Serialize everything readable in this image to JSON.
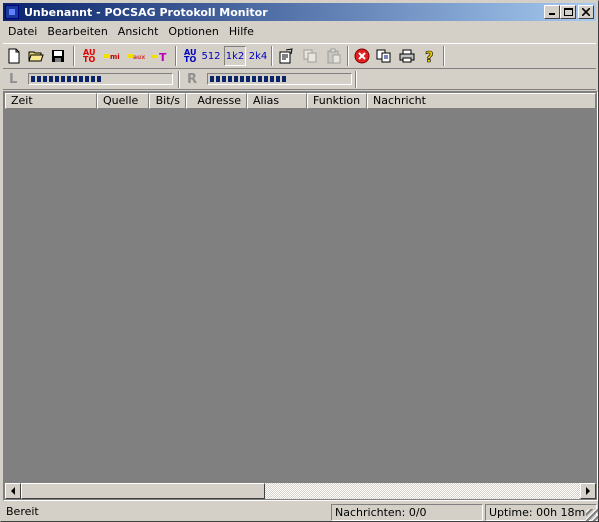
{
  "window": {
    "title": "Unbenannt - POCSAG Protokoll Monitor",
    "icon": "app-icon",
    "controls": [
      "minimize",
      "maximize",
      "close"
    ]
  },
  "menu": [
    "Datei",
    "Bearbeiten",
    "Ansicht",
    "Optionen",
    "Hilfe"
  ],
  "toolbar": {
    "auto_label": "AU TO",
    "baud_512": "512",
    "baud_1k2": "1k2",
    "baud_2k4": "2k4"
  },
  "levels": {
    "left_label": "L",
    "right_label": "R",
    "left_level_fraction": 0.5,
    "right_level_fraction": 0.55
  },
  "list": {
    "columns": [
      "Zeit",
      "Quelle",
      "Bit/s",
      "Adresse",
      "Alias",
      "Funktion",
      "Nachricht"
    ],
    "rows": []
  },
  "status": {
    "ready": "Bereit",
    "messages": "Nachrichten:  0/0",
    "uptime": "Uptime: 00h 18m"
  },
  "colors": {
    "title_start": "#0a246a",
    "title_end": "#a6caf0",
    "list_background": "#808080",
    "meter_fill": "#0a246a"
  }
}
